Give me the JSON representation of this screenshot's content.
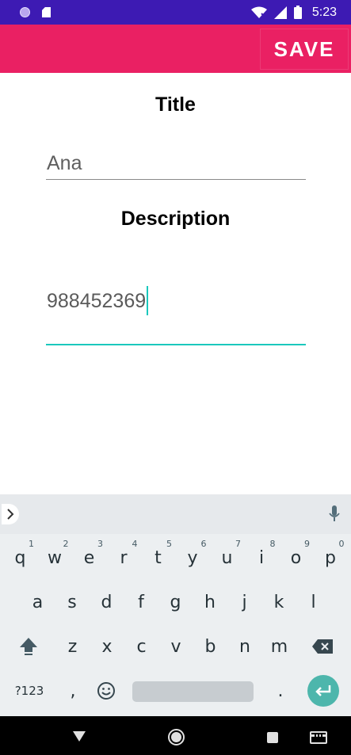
{
  "status_bar": {
    "time": "5:23",
    "icons": [
      "circle-notification-icon",
      "sd-card-icon",
      "wifi-icon",
      "signal-icon",
      "battery-icon"
    ]
  },
  "app_bar": {
    "save_label": "SAVE",
    "color": "#ea2063"
  },
  "form": {
    "title_label": "Title",
    "title_value": "Ana",
    "description_label": "Description",
    "description_value": "988452369",
    "accent_color": "#1bc8bd"
  },
  "keyboard": {
    "row1": [
      {
        "key": "q",
        "hint": "1"
      },
      {
        "key": "w",
        "hint": "2"
      },
      {
        "key": "e",
        "hint": "3"
      },
      {
        "key": "r",
        "hint": "4"
      },
      {
        "key": "t",
        "hint": "5"
      },
      {
        "key": "y",
        "hint": "6"
      },
      {
        "key": "u",
        "hint": "7"
      },
      {
        "key": "i",
        "hint": "8"
      },
      {
        "key": "o",
        "hint": "9"
      },
      {
        "key": "p",
        "hint": "0"
      }
    ],
    "row2": [
      "a",
      "s",
      "d",
      "f",
      "g",
      "h",
      "j",
      "k",
      "l"
    ],
    "row3": [
      "z",
      "x",
      "c",
      "v",
      "b",
      "n",
      "m"
    ],
    "symbols_label": "?123",
    "comma_label": ",",
    "period_label": ".",
    "icons": [
      "chevron-right-icon",
      "mic-icon",
      "shift-icon",
      "backspace-icon",
      "emoji-icon",
      "enter-icon"
    ]
  },
  "nav_bar": {
    "icons": [
      "back-icon",
      "home-icon",
      "recents-icon",
      "keyboard-icon"
    ]
  }
}
